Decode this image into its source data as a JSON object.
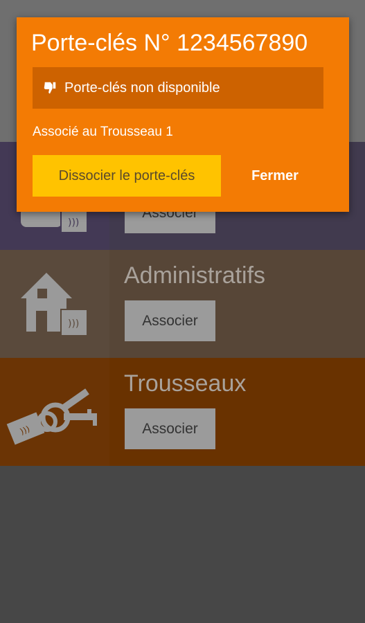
{
  "dialog": {
    "title": "Porte-clés N° 1234567890",
    "status_icon": "thumbs-down-icon",
    "status_text": "Porte-clés non disponible",
    "association_text": "Associé au Trousseau 1",
    "dissociate_label": "Dissocier le porte-clés",
    "close_label": "Fermer"
  },
  "rows": [
    {
      "title": "",
      "button_label": "Associer",
      "icon": "device-nfc-icon"
    },
    {
      "title": "Administratifs",
      "button_label": "Associer",
      "icon": "house-nfc-icon"
    },
    {
      "title": "Trousseaux",
      "button_label": "Associer",
      "icon": "keyring-nfc-icon"
    }
  ],
  "colors": {
    "dialog_bg": "#f37b04",
    "status_bar_bg": "#cd6200",
    "primary_button_bg": "#ffc300",
    "row_purple": "#413a4e",
    "row_brown": "#574637",
    "row_orange": "#693200"
  }
}
